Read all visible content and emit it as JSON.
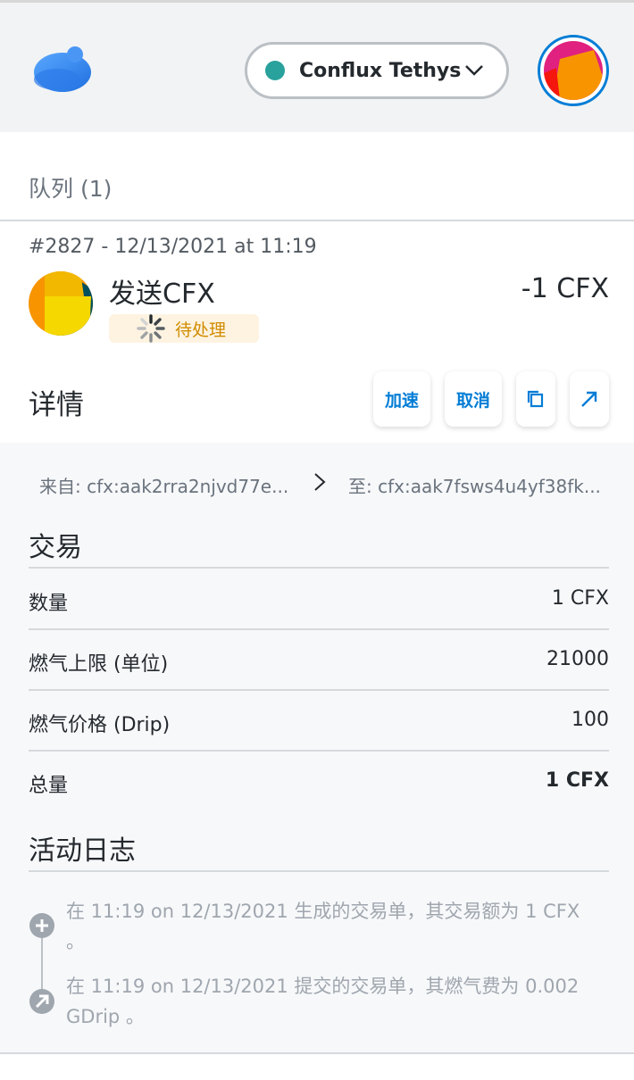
{
  "header": {
    "network_name": "Conflux Tethys",
    "network_dot_color": "#29a19c"
  },
  "queue": {
    "title": "队列 (1)"
  },
  "transaction": {
    "meta": "#2827 - 12/13/2021 at 11:19",
    "title": "发送CFX",
    "amount": "-1 CFX",
    "status": "待处理"
  },
  "details": {
    "title": "详情",
    "speed_up_label": "加速",
    "cancel_label": "取消",
    "copy_icon": "copy-icon",
    "view_icon": "external-link-icon"
  },
  "addresses": {
    "from": "来自: cfx:aak2rra2njvd77e...",
    "to": "至: cfx:aak7fsws4u4yf38fk..."
  },
  "tx_section": {
    "title": "交易",
    "rows": [
      {
        "label": "数量",
        "value": "1 CFX"
      },
      {
        "label": "燃气上限 (单位)",
        "value": "21000"
      },
      {
        "label": "燃气价格 (Drip)",
        "value": "100"
      },
      {
        "label": "总量",
        "value": "1 CFX"
      }
    ]
  },
  "activity": {
    "title": "活动日志",
    "entries": [
      {
        "icon": "plus-circle-icon",
        "text": "在 11:19 on 12/13/2021 生成的交易单，其交易额为 1 CFX 。"
      },
      {
        "icon": "arrow-up-right-circle-icon",
        "text": "在 11:19 on 12/13/2021 提交的交易单，其燃气费为 0.002 GDrip 。"
      }
    ]
  },
  "colors": {
    "accent": "#037dd6",
    "pending": "#d18c00",
    "pending_bg": "#fef3e1"
  }
}
